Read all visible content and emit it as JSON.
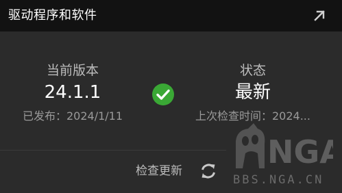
{
  "header": {
    "title": "驱动程序和软件",
    "expand_icon": "expand-arrow-icon"
  },
  "version": {
    "label": "当前版本",
    "value": "24.1.1",
    "released": "已发布：2024/1/11"
  },
  "status": {
    "label": "状态",
    "value": "最新",
    "last_checked": "上次检查时间：2024..."
  },
  "status_icon": "checkmark-circle-icon",
  "colors": {
    "check": "#3aa835",
    "header_bg": "#121212",
    "card_bg": "#2b2b2b"
  },
  "action": {
    "check_updates_label": "检查更新",
    "refresh_icon": "refresh-icon"
  },
  "watermark": {
    "logo_text": "NGA",
    "url": "BBS.NGA.CN"
  }
}
